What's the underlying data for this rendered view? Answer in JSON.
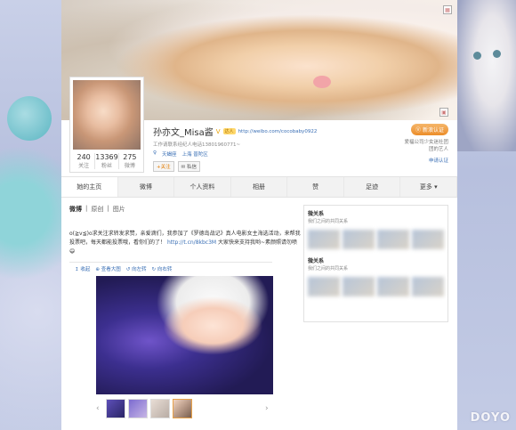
{
  "profile": {
    "name": "孙亦文_Misa酱",
    "tag": "达人",
    "url": "http://weibo.com/cocobaby0922",
    "desc": "工作请联系经纪人电话13801960771~",
    "gender_loc": "天蝎座",
    "location": "上海 普陀区",
    "follow_label": "+关注",
    "msg_label": "私信",
    "stats": [
      {
        "num": "240",
        "label": "关注"
      },
      {
        "num": "13369",
        "label": "粉丝"
      },
      {
        "num": "275",
        "label": "微博"
      }
    ]
  },
  "cert": {
    "button": "新浪认证",
    "text": "爱福公司少女迷社团团的艺人",
    "link": "申请认证"
  },
  "tabs": [
    "她的主页",
    "微博",
    "个人资料",
    "相册",
    "赞",
    "足迹",
    "更多 ▾"
  ],
  "feed": {
    "filters": [
      "微博",
      "原创",
      "图片"
    ],
    "post_text": "o(≧v≦)o求关注求转发求赞，亲爱滴们，我参加了《罗德岛战记》真人电影女主海选活动，来帮我投票吧，每天都能投票哦，看你们的了！",
    "post_link": "http://t.cn/8kbc3M",
    "post_tail": "大家快来支持我哟~素颜照请勿喷",
    "tools": [
      "↥ 收起",
      "⊕ 查看大图",
      "↺ 向左转",
      "↻ 向右转"
    ]
  },
  "sidebar": {
    "title": "微关系",
    "subtitle": "我们之间的共同关系",
    "title2": "微关系",
    "subtitle2": "我们之间的共同关系"
  },
  "watermark": "DOYO",
  "colors": {
    "link": "#3a6fb5",
    "accent": "#ec8d2a",
    "background": "#b7c0de"
  }
}
